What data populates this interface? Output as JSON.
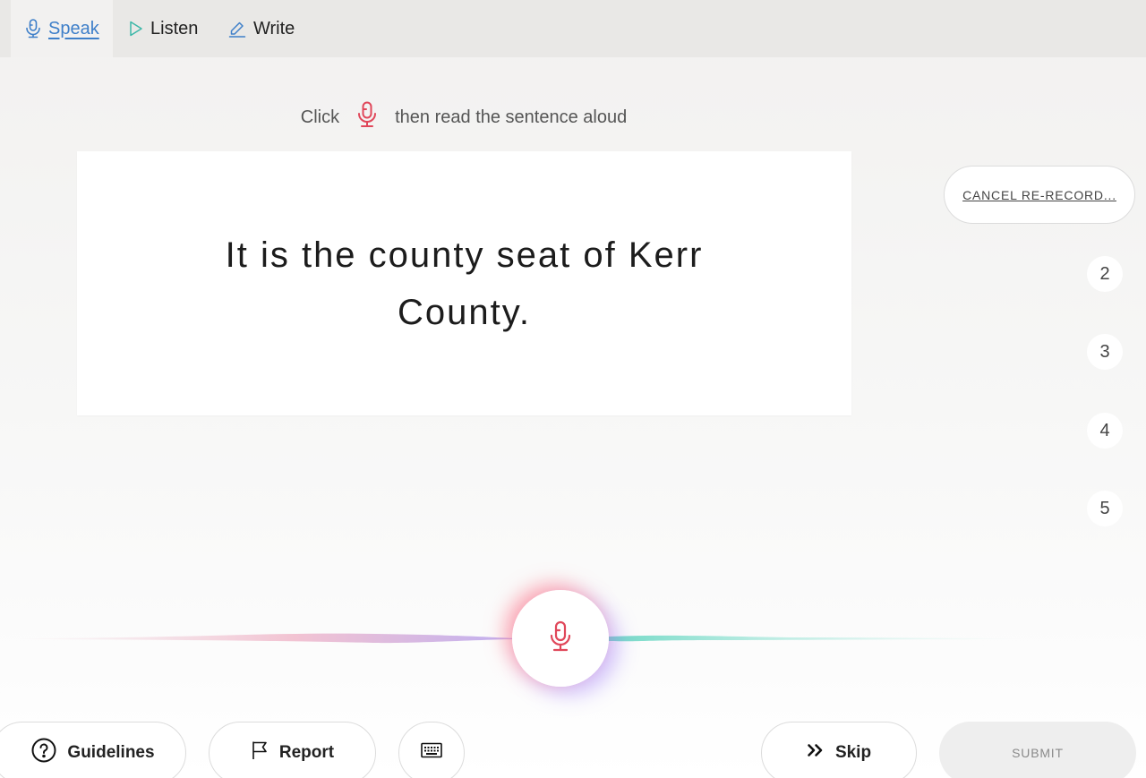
{
  "nav": {
    "tabs": [
      {
        "label": "Speak",
        "icon": "microphone-icon",
        "active": true
      },
      {
        "label": "Listen",
        "icon": "play-icon",
        "active": false
      },
      {
        "label": "Write",
        "icon": "pencil-icon",
        "active": false
      }
    ]
  },
  "instruction": {
    "before": "Click",
    "after": "then read the sentence aloud"
  },
  "sentence": "It is the county seat of Kerr County.",
  "sidebar": {
    "cancel_label": "CANCEL RE-RECORD...",
    "steps": [
      "2",
      "3",
      "4",
      "5"
    ]
  },
  "footer": {
    "guidelines_label": "Guidelines",
    "report_label": "Report",
    "skip_label": "Skip",
    "submit_label": "SUBMIT"
  },
  "colors": {
    "accent_blue": "#3e7fc9",
    "mic_red": "#e0475a",
    "listen_teal": "#3cb7a8"
  }
}
